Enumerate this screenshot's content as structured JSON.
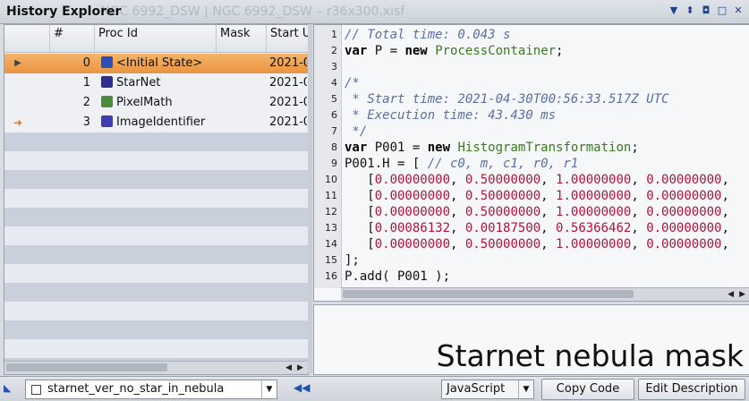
{
  "window": {
    "title": "History Explorer",
    "ghost_title": "NGC 6992_DSW | NGC 6992_DSW – r36x300.xisf",
    "controls": [
      "menu-arrow-icon",
      "pin-icon",
      "float-icon",
      "maximize-icon",
      "close-icon"
    ]
  },
  "history_table": {
    "columns": [
      "#",
      "Proc Id",
      "Mask",
      "Start U"
    ],
    "rows": [
      {
        "num": "0",
        "proc_id": "<Initial State>",
        "start": "2021-0",
        "icon_color": "#2d4fb5",
        "marker": "play"
      },
      {
        "num": "1",
        "proc_id": "StarNet",
        "start": "2021-0",
        "icon_color": "#2c2f8f",
        "marker": ""
      },
      {
        "num": "2",
        "proc_id": "PixelMath",
        "start": "2021-0",
        "icon_color": "#4b8a3a",
        "marker": ""
      },
      {
        "num": "3",
        "proc_id": "ImageIdentifier",
        "start": "2021-0",
        "icon_color": "#3d3fb0",
        "marker": "arrow"
      }
    ],
    "selected_row": 0
  },
  "code": {
    "lines": [
      {
        "n": "1",
        "parts": [
          {
            "t": "// Total time: 0.043 s",
            "c": "comment"
          }
        ]
      },
      {
        "n": "2",
        "parts": [
          {
            "t": "var",
            "c": "key"
          },
          {
            "t": " P = ",
            "c": "plain"
          },
          {
            "t": "new",
            "c": "key"
          },
          {
            "t": " ",
            "c": "plain"
          },
          {
            "t": "ProcessContainer",
            "c": "class"
          },
          {
            "t": ";",
            "c": "plain"
          }
        ]
      },
      {
        "n": "3",
        "parts": []
      },
      {
        "n": "4",
        "parts": [
          {
            "t": "/*",
            "c": "comment"
          }
        ]
      },
      {
        "n": "5",
        "parts": [
          {
            "t": " * Start time: 2021-04-30T00:56:33.517Z UTC",
            "c": "comment"
          }
        ]
      },
      {
        "n": "6",
        "parts": [
          {
            "t": " * Execution time: 43.430 ms",
            "c": "comment"
          }
        ]
      },
      {
        "n": "7",
        "parts": [
          {
            "t": " */",
            "c": "comment"
          }
        ]
      },
      {
        "n": "8",
        "parts": [
          {
            "t": "var",
            "c": "key"
          },
          {
            "t": " P001 = ",
            "c": "plain"
          },
          {
            "t": "new",
            "c": "key"
          },
          {
            "t": " ",
            "c": "plain"
          },
          {
            "t": "HistogramTransformation",
            "c": "class"
          },
          {
            "t": ";",
            "c": "plain"
          }
        ]
      },
      {
        "n": "9",
        "parts": [
          {
            "t": "P001.H = [ ",
            "c": "plain"
          },
          {
            "t": "// c0, m, c1, r0, r1",
            "c": "comment"
          }
        ]
      },
      {
        "n": "10",
        "parts": [
          {
            "t": "   [",
            "c": "plain"
          },
          {
            "t": "0.00000000",
            "c": "num"
          },
          {
            "t": ", ",
            "c": "plain"
          },
          {
            "t": "0.50000000",
            "c": "num"
          },
          {
            "t": ", ",
            "c": "plain"
          },
          {
            "t": "1.00000000",
            "c": "num"
          },
          {
            "t": ", ",
            "c": "plain"
          },
          {
            "t": "0.00000000",
            "c": "num"
          },
          {
            "t": ",",
            "c": "plain"
          }
        ]
      },
      {
        "n": "11",
        "parts": [
          {
            "t": "   [",
            "c": "plain"
          },
          {
            "t": "0.00000000",
            "c": "num"
          },
          {
            "t": ", ",
            "c": "plain"
          },
          {
            "t": "0.50000000",
            "c": "num"
          },
          {
            "t": ", ",
            "c": "plain"
          },
          {
            "t": "1.00000000",
            "c": "num"
          },
          {
            "t": ", ",
            "c": "plain"
          },
          {
            "t": "0.00000000",
            "c": "num"
          },
          {
            "t": ",",
            "c": "plain"
          }
        ]
      },
      {
        "n": "12",
        "parts": [
          {
            "t": "   [",
            "c": "plain"
          },
          {
            "t": "0.00000000",
            "c": "num"
          },
          {
            "t": ", ",
            "c": "plain"
          },
          {
            "t": "0.50000000",
            "c": "num"
          },
          {
            "t": ", ",
            "c": "plain"
          },
          {
            "t": "1.00000000",
            "c": "num"
          },
          {
            "t": ", ",
            "c": "plain"
          },
          {
            "t": "0.00000000",
            "c": "num"
          },
          {
            "t": ",",
            "c": "plain"
          }
        ]
      },
      {
        "n": "13",
        "parts": [
          {
            "t": "   [",
            "c": "plain"
          },
          {
            "t": "0.00086132",
            "c": "num"
          },
          {
            "t": ", ",
            "c": "plain"
          },
          {
            "t": "0.00187500",
            "c": "num"
          },
          {
            "t": ", ",
            "c": "plain"
          },
          {
            "t": "0.56366462",
            "c": "num"
          },
          {
            "t": ", ",
            "c": "plain"
          },
          {
            "t": "0.00000000",
            "c": "num"
          },
          {
            "t": ",",
            "c": "plain"
          }
        ]
      },
      {
        "n": "14",
        "parts": [
          {
            "t": "   [",
            "c": "plain"
          },
          {
            "t": "0.00000000",
            "c": "num"
          },
          {
            "t": ", ",
            "c": "plain"
          },
          {
            "t": "0.50000000",
            "c": "num"
          },
          {
            "t": ", ",
            "c": "plain"
          },
          {
            "t": "1.00000000",
            "c": "num"
          },
          {
            "t": ", ",
            "c": "plain"
          },
          {
            "t": "0.00000000",
            "c": "num"
          },
          {
            "t": ",",
            "c": "plain"
          }
        ]
      },
      {
        "n": "15",
        "parts": [
          {
            "t": "];",
            "c": "plain"
          }
        ]
      },
      {
        "n": "16",
        "parts": [
          {
            "t": "P.add( P001 );",
            "c": "plain"
          }
        ]
      }
    ]
  },
  "caption": "Starnet nebula mask",
  "bottom": {
    "project_combo": "starnet_ver_no_star_in_nebula",
    "language_combo": "JavaScript",
    "copy_button": "Copy Code",
    "edit_button": "Edit Description"
  }
}
